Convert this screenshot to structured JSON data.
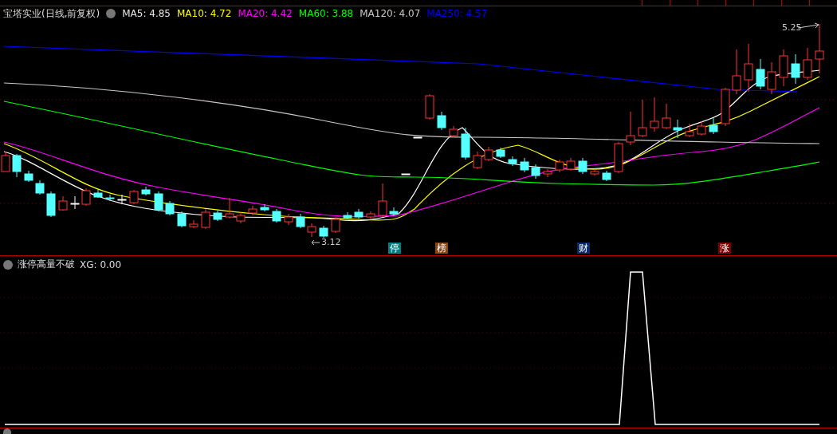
{
  "chart": {
    "title": "宝塔实业(日线,前复权)",
    "ma_legend": [
      {
        "label": "MA5: 4.85",
        "color": "#e6e6e6"
      },
      {
        "label": "MA10: 4.72",
        "color": "#ffff00"
      },
      {
        "label": "MA20: 4.42",
        "color": "#ff00ff"
      },
      {
        "label": "MA60: 3.88",
        "color": "#00ff00"
      },
      {
        "label": "MA120: 4.07",
        "color": "#c8c8c8"
      },
      {
        "label": "MA250: 4.57",
        "color": "#0000ff"
      }
    ],
    "high_label": "5.25",
    "low_label": "3.12",
    "event_markers": [
      {
        "text": "停",
        "color": "#008080"
      },
      {
        "text": "榜",
        "color": "#8b4513"
      },
      {
        "text": "财",
        "color": "#0a2a6a"
      },
      {
        "text": "涨",
        "color": "#800000"
      }
    ]
  },
  "indicator": {
    "title": "涨停高量不破",
    "value": "XG: 0.00"
  }
}
